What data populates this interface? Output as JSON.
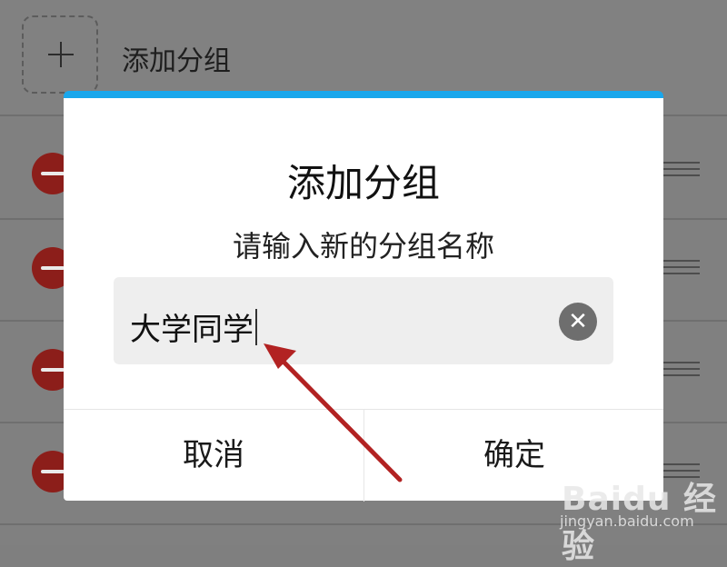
{
  "header": {
    "add_group_label": "添加分组"
  },
  "dialog": {
    "title": "添加分组",
    "subtitle": "请输入新的分组名称",
    "input_value": "大学同学",
    "clear_icon": "clear-icon",
    "cancel_label": "取消",
    "confirm_label": "确定",
    "accent_color": "#1aa7ec"
  },
  "watermark": {
    "logo_text": "Baidu 经验",
    "url": "jingyan.baidu.com"
  }
}
